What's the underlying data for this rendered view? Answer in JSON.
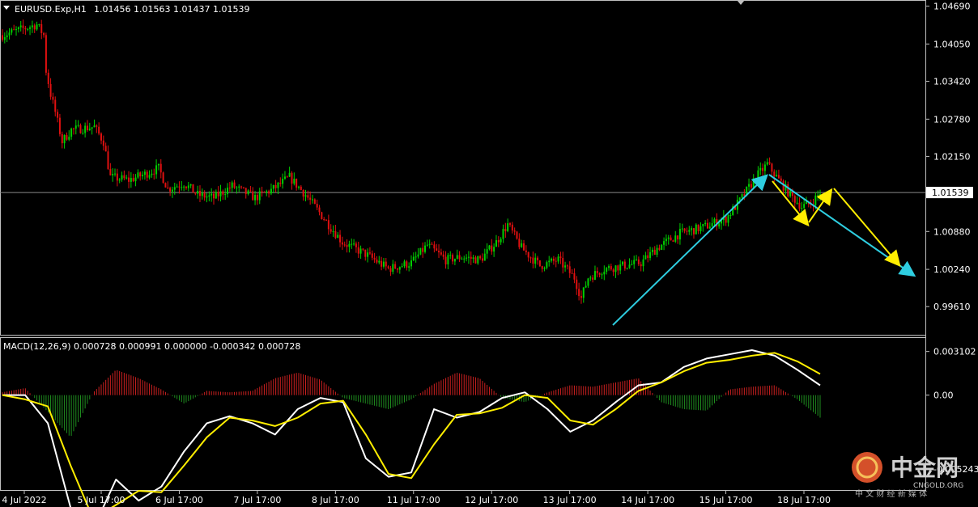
{
  "header": {
    "symbol_label": "EURUSD.Exp,H1",
    "ohlc_label": "1.01456 1.01563 1.01437 1.01539"
  },
  "macd_header": {
    "label": "MACD(12,26,9) 0.000728 0.000991 0.000000 -0.000342 0.000728"
  },
  "watermark": {
    "name": "中金网",
    "domain": "CNGOLD.ORG",
    "tagline": "中 文 财 经 新 媒 体"
  },
  "colors": {
    "background": "#000000",
    "frame": "#c0c0c0",
    "bull": "#00d000",
    "bear": "#e01010",
    "arrow_cyan": "#2ecde0",
    "arrow_yellow": "#ffee00",
    "macd_line": "#ffffff",
    "signal_line": "#ffee00",
    "hist_pos": "#cc2020",
    "hist_neg": "#1f8f1f",
    "current_line": "#8a8a8a"
  },
  "chart_data": [
    {
      "type": "candlestick",
      "title": "EURUSD.Exp,H1",
      "x_labels": [
        "4 Jul 2022",
        "5 Jul 17:00",
        "6 Jul 17:00",
        "7 Jul 17:00",
        "8 Jul 17:00",
        "11 Jul 17:00",
        "12 Jul 17:00",
        "13 Jul 17:00",
        "14 Jul 17:00",
        "15 Jul 17:00",
        "18 Jul 17:00"
      ],
      "y_ticks": [
        "1.04690",
        "1.04050",
        "1.03420",
        "1.02780",
        "1.02150",
        "1.00880",
        "1.00240",
        "0.99610"
      ],
      "current_price_label": "1.01539",
      "ylim": [
        0.9938,
        1.0474
      ],
      "trend_path": [
        [
          0,
          1.042
        ],
        [
          10,
          1.0432
        ],
        [
          15,
          1.0438
        ],
        [
          18,
          1.042
        ],
        [
          19,
          1.036
        ],
        [
          21,
          1.032
        ],
        [
          23,
          1.029
        ],
        [
          26,
          1.024
        ],
        [
          30,
          1.026
        ],
        [
          40,
          1.0265
        ],
        [
          44,
          1.024
        ],
        [
          47,
          1.018
        ],
        [
          55,
          1.0175
        ],
        [
          62,
          1.0185
        ],
        [
          68,
          1.0195
        ],
        [
          72,
          1.016
        ],
        [
          79,
          1.017
        ],
        [
          85,
          1.015
        ],
        [
          92,
          1.0145
        ],
        [
          100,
          1.0165
        ],
        [
          110,
          1.0145
        ],
        [
          118,
          1.016
        ],
        [
          125,
          1.018
        ],
        [
          132,
          1.015
        ],
        [
          140,
          1.011
        ],
        [
          148,
          1.007
        ],
        [
          158,
          1.005
        ],
        [
          168,
          1.0025
        ],
        [
          178,
          1.0035
        ],
        [
          185,
          1.0065
        ],
        [
          193,
          1.004
        ],
        [
          200,
          1.0045
        ],
        [
          208,
          1.004
        ],
        [
          215,
          1.007
        ],
        [
          220,
          1.01
        ],
        [
          226,
          1.006
        ],
        [
          234,
          1.003
        ],
        [
          242,
          1.004
        ],
        [
          249,
          1.001
        ],
        [
          252,
          0.9975
        ],
        [
          255,
          1.001
        ],
        [
          262,
          1.0025
        ],
        [
          270,
          1.003
        ],
        [
          278,
          1.0035
        ],
        [
          285,
          1.006
        ],
        [
          295,
          1.0085
        ],
        [
          305,
          1.0095
        ],
        [
          315,
          1.011
        ],
        [
          322,
          1.0145
        ],
        [
          328,
          1.018
        ],
        [
          333,
          1.0202
        ],
        [
          338,
          1.0175
        ],
        [
          343,
          1.015
        ],
        [
          348,
          1.013
        ],
        [
          352,
          1.0135
        ],
        [
          356,
          1.0154
        ]
      ]
    },
    {
      "type": "line",
      "title": "MACD(12,26,9)",
      "series": [
        {
          "name": "MACD",
          "values": [
            0.0,
            0.0,
            -0.002,
            -0.008,
            -0.0095,
            -0.006,
            -0.0075,
            -0.0065,
            -0.004,
            -0.002,
            -0.0015,
            -0.002,
            -0.0028,
            -0.001,
            -0.0002,
            -0.0005,
            -0.0045,
            -0.0058,
            -0.0055,
            -0.001,
            -0.0016,
            -0.0012,
            -0.0002,
            0.0002,
            -0.001,
            -0.0026,
            -0.0018,
            -0.0005,
            0.0007,
            0.0009,
            0.002,
            0.0026,
            0.0029,
            0.0032,
            0.0028,
            0.0018,
            0.0007
          ]
        },
        {
          "name": "Signal",
          "values": [
            0.0,
            -0.0003,
            -0.0008,
            -0.005,
            -0.0088,
            -0.0078,
            -0.0068,
            -0.0069,
            -0.005,
            -0.003,
            -0.0016,
            -0.0018,
            -0.0022,
            -0.0016,
            -0.0006,
            -0.0004,
            -0.0028,
            -0.0056,
            -0.0059,
            -0.0035,
            -0.0014,
            -0.0013,
            -0.0009,
            0.0,
            -0.0002,
            -0.0018,
            -0.0021,
            -0.001,
            0.0003,
            0.0009,
            0.0017,
            0.0023,
            0.0025,
            0.0028,
            0.003,
            0.0024,
            0.0015
          ]
        }
      ],
      "histogram": [
        0.0002,
        0.0005,
        -0.0012,
        -0.003,
        0.0002,
        0.0018,
        0.0012,
        0.0004,
        -0.0006,
        0.0003,
        0.0002,
        0.0003,
        0.0012,
        0.0016,
        0.0011,
        -0.0002,
        -0.0006,
        -0.001,
        -0.0003,
        0.0008,
        0.0016,
        0.0012,
        -0.0002,
        -0.0005,
        0.0002,
        0.0007,
        0.0006,
        0.0009,
        0.0012,
        -0.0005,
        -0.001,
        -0.0011,
        0.0004,
        0.0006,
        0.0007,
        -0.0003,
        -0.0016
      ],
      "y_ticks": [
        "0.003102",
        "0.00",
        "-0.005243"
      ],
      "ylim": [
        -0.0064,
        0.0036
      ]
    }
  ]
}
